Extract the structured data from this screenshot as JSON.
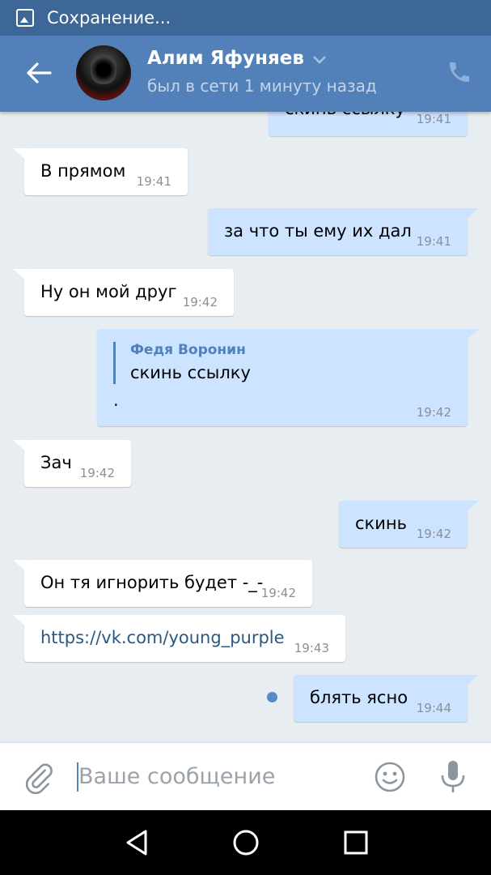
{
  "statusbar": {
    "text": "Сохранение...",
    "icon": "image-icon"
  },
  "header": {
    "name": "Алим Яфуняев",
    "status": "был в сети 1 минуту назад",
    "back_icon": "arrow-left-icon",
    "call_icon": "phone-icon",
    "accent": "#5181b8"
  },
  "messages": [
    {
      "dir": "out",
      "text": "скинь ссылку",
      "time": "19:41"
    },
    {
      "dir": "in",
      "text": "В прямом",
      "time": "19:41"
    },
    {
      "dir": "out",
      "text": "за что ты ему их дал",
      "time": "19:41"
    },
    {
      "dir": "in",
      "text": "Ну он мой друг",
      "time": "19:42"
    },
    {
      "dir": "out",
      "reply_to_name": "Федя Воронин",
      "reply_to_text": "скинь ссылку",
      "text": ".",
      "time": "19:42"
    },
    {
      "dir": "in",
      "text": "Зач",
      "time": "19:42"
    },
    {
      "dir": "out",
      "text": "скинь",
      "time": "19:42"
    },
    {
      "dir": "in",
      "text": "Он тя игнорить будет -_-",
      "time": "19:42"
    },
    {
      "dir": "in",
      "text": "https://vk.com/young_purple",
      "time": "19:43",
      "is_link": true
    },
    {
      "dir": "out",
      "text": "блять ясно",
      "time": "19:44",
      "unread": true
    }
  ],
  "composer": {
    "placeholder": "Ваше сообщение",
    "attach_icon": "paperclip-icon",
    "emoji_icon": "smile-icon",
    "voice_icon": "microphone-icon"
  },
  "navbar": {
    "back_icon": "triangle-back-icon",
    "home_icon": "circle-home-icon",
    "recents_icon": "square-recents-icon"
  }
}
